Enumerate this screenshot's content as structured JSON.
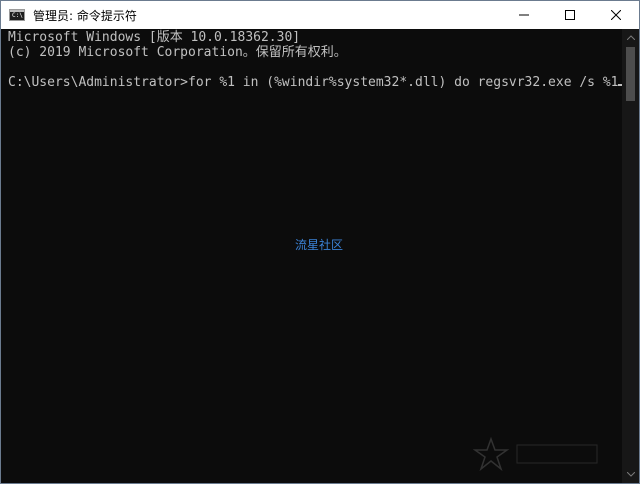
{
  "window": {
    "title": "管理员: 命令提示符",
    "icon": "console-icon",
    "icon_glyph": "C:\\"
  },
  "controls": {
    "minimize": "minimize-icon",
    "maximize": "maximize-icon",
    "close": "close-icon"
  },
  "console": {
    "lines": [
      "Microsoft Windows [版本 10.0.18362.30]",
      "(c) 2019 Microsoft Corporation。保留所有权利。",
      "",
      "C:\\Users\\Administrator>for %1 in (%windir%system32*.dll) do regsvr32.exe /s %1"
    ],
    "text_color": "#c0c0c0",
    "background": "#0c0c0c"
  },
  "watermark": {
    "text": "流星社区",
    "color": "#3b82d6"
  }
}
